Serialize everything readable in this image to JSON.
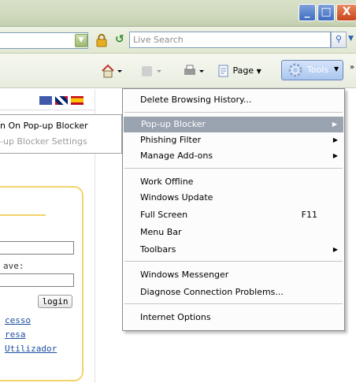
{
  "window": {
    "buttons": {
      "minimize": "_",
      "maximize": "□",
      "close": "X"
    }
  },
  "address_bar": {
    "search_placeholder": "Live Search"
  },
  "command_bar": {
    "page_label": "Page",
    "tools_label": "Tools"
  },
  "popup_submenu": {
    "items": [
      "n On Pop-up Blocker",
      "-up Blocker Settings"
    ]
  },
  "login": {
    "password_label": "ave:",
    "login_button": "login",
    "links": [
      "cesso",
      "resa",
      "Utilizador"
    ]
  },
  "tools_menu": {
    "items": [
      {
        "label": "Delete Browsing History...",
        "arrow": ""
      },
      {
        "label": "Pop-up Blocker",
        "arrow": "▶"
      },
      {
        "label": "Phishing Filter",
        "arrow": "▶"
      },
      {
        "label": "Manage Add-ons",
        "arrow": "▶"
      },
      {
        "label": "Work Offline",
        "arrow": ""
      },
      {
        "label": "Windows Update",
        "arrow": ""
      },
      {
        "label": "Full Screen",
        "accel": "F11"
      },
      {
        "label": "Menu Bar",
        "arrow": ""
      },
      {
        "label": "Toolbars",
        "arrow": "▶"
      },
      {
        "label": "Windows Messenger",
        "arrow": ""
      },
      {
        "label": "Diagnose Connection Problems...",
        "arrow": ""
      },
      {
        "label": "Internet Options",
        "arrow": ""
      }
    ],
    "highlighted_index": 1
  },
  "colors": {
    "titlebar": "#cfd9bc",
    "highlight": "#9aa3b0",
    "login_border": "#f2d36b",
    "link": "#1f4fa0"
  }
}
